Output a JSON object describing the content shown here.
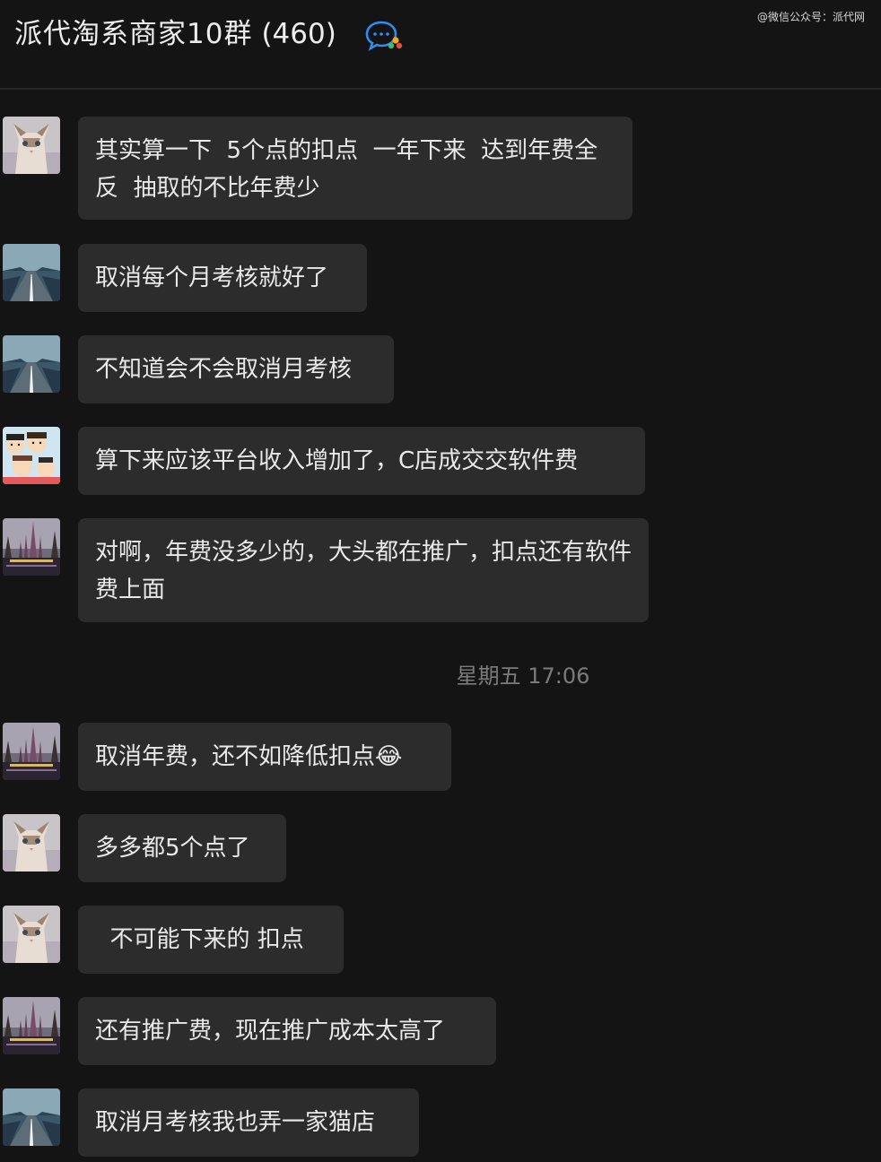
{
  "header": {
    "group_name": "派代淘系商家10群",
    "member_count": "(460)",
    "icon": "chat-bubbles-icon"
  },
  "watermark": "@微信公众号：派代网",
  "timestamp": "星期五 17:06",
  "messages": [
    {
      "avatar": "cat",
      "text": "其实算一下  5个点的扣点  一年下来  达到年费全反  抽取的不比年费少"
    },
    {
      "avatar": "road",
      "text": "取消每个月考核就好了"
    },
    {
      "avatar": "road",
      "text": "不知道会不会取消月考核"
    },
    {
      "avatar": "cartoon",
      "text": "算下来应该平台收入增加了，C店成交交软件费"
    },
    {
      "avatar": "castle",
      "text": "对啊，年费没多少的，大头都在推广，扣点还有软件费上面"
    },
    {
      "avatar": "castle",
      "text": "取消年费，还不如降低扣点😂"
    },
    {
      "avatar": "cat",
      "text": "多多都5个点了"
    },
    {
      "avatar": "cat",
      "text": "  不可能下来的 扣点"
    },
    {
      "avatar": "castle",
      "text": "还有推广费，现在推广成本太高了"
    },
    {
      "avatar": "road",
      "text": "取消月考核我也弄一家猫店"
    }
  ]
}
